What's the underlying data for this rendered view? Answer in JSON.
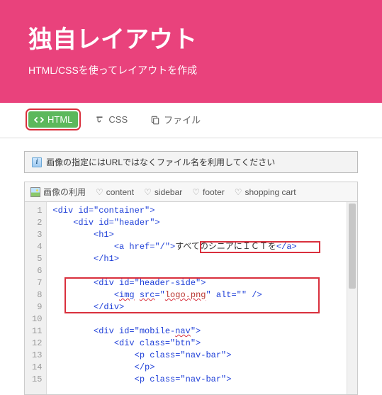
{
  "header": {
    "title": "独自レイアウト",
    "subtitle": "HTML/CSSを使ってレイアウトを作成"
  },
  "tabs": {
    "html": "HTML",
    "css": "CSS",
    "file": "ファイル"
  },
  "notice": "画像の指定にはURLではなくファイル名を利用してください",
  "toolbar": {
    "image": "画像の利用",
    "content": "content",
    "sidebar": "sidebar",
    "footer": "footer",
    "cart": "shopping cart"
  },
  "code": {
    "l1": "<div id=\"container\">",
    "l2": "    <div id=\"header\">",
    "l3": "        <h1>",
    "l4a": "            <a href=\"/\">",
    "l4b": "すべてのシニアにＩＣＴを",
    "l4c": "</a>",
    "l5": "        </h1>",
    "l6": "",
    "l7": "        <div id=\"header-side\">",
    "l8a": "            <",
    "l8b": "img",
    "l8c": " ",
    "l8d": "src",
    "l8e": "=\"",
    "l8f": "logo.png",
    "l8g": "\" alt=\"\" />",
    "l9": "        </div>",
    "l10": "",
    "l11": "        <div id=\"mobile-",
    "l11b": "nav",
    "l11c": "\">",
    "l12": "            <div class=\"btn\">",
    "l13": "                <p class=\"nav-bar\">",
    "l14": "                </p>",
    "l15": "                <p class=\"nav-bar\">"
  },
  "gutter": [
    "1",
    "2",
    "3",
    "4",
    "5",
    "6",
    "7",
    "8",
    "9",
    "10",
    "11",
    "12",
    "13",
    "14",
    "15"
  ]
}
